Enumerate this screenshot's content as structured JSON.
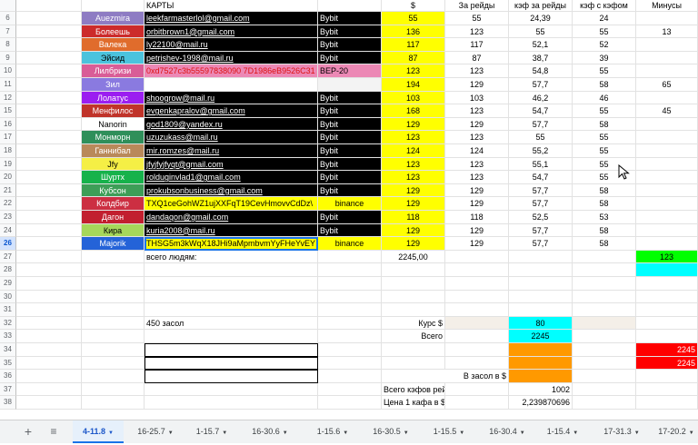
{
  "columns": [
    "col-name",
    "col-contact",
    "col-exchange",
    "col-dollar",
    "col-raids",
    "col-kaf-raids",
    "col-kaf-with-kaf",
    "col-minus"
  ],
  "header_row": {
    "row": "",
    "cells": [
      "",
      "КАРТЫ",
      "",
      "$",
      "За рейды",
      "кэф за рейды",
      "кэф с кэфом",
      "Минусы"
    ]
  },
  "rows": [
    {
      "row": "6",
      "name": "Auezmira",
      "contact": "leekfarmasterlol@gmail.com",
      "exchange": "Bybit",
      "dollar": "55",
      "raids": "55",
      "kaf": "24,39",
      "kafkaf": "24",
      "minus": ""
    },
    {
      "row": "7",
      "name": "Болеешь",
      "contact": "orbitbrown1@gmail.com",
      "exchange": "Bybit",
      "dollar": "136",
      "raids": "123",
      "kaf": "55",
      "kafkaf": "55",
      "minus": "13"
    },
    {
      "row": "8",
      "name": "Валека",
      "contact": "ly22100@mail.ru",
      "exchange": "Bybit",
      "dollar": "117",
      "raids": "117",
      "kaf": "52,1",
      "kafkaf": "52",
      "minus": ""
    },
    {
      "row": "9",
      "name": "Эйсид",
      "contact": "petrishev-1998@mail.ru",
      "exchange": "Bybit",
      "dollar": "87",
      "raids": "87",
      "kaf": "38,7",
      "kafkaf": "39",
      "minus": ""
    },
    {
      "row": "10",
      "name": "Лилбризи",
      "contact": "0xd7527c3b55597838090 7D1986eB9526C31",
      "exchange": "BEP-20",
      "dollar": "123",
      "raids": "123",
      "kaf": "54,8",
      "kafkaf": "55",
      "minus": ""
    },
    {
      "row": "11",
      "name": "Зил",
      "contact": "",
      "exchange": "",
      "dollar": "194",
      "raids": "129",
      "kaf": "57,7",
      "kafkaf": "58",
      "minus": "65"
    },
    {
      "row": "12",
      "name": "Лолатус",
      "contact": "shoogrow@mail.ru",
      "exchange": "Bybit",
      "dollar": "103",
      "raids": "103",
      "kaf": "46,2",
      "kafkaf": "46",
      "minus": ""
    },
    {
      "row": "15",
      "name": "Менфилос",
      "contact": "evgenkapralov@gmail.com",
      "exchange": "Bybit",
      "dollar": "168",
      "raids": "123",
      "kaf": "54,7",
      "kafkaf": "55",
      "minus": "45"
    },
    {
      "row": "16",
      "name": "Nanorin",
      "contact": "god1809@yandex.ru",
      "exchange": "Bybit",
      "dollar": "129",
      "raids": "129",
      "kaf": "57,7",
      "kafkaf": "58",
      "minus": ""
    },
    {
      "row": "17",
      "name": "Монморн",
      "contact": "uzuzukass@mail.ru",
      "exchange": "Bybit",
      "dollar": "123",
      "raids": "123",
      "kaf": "55",
      "kafkaf": "55",
      "minus": ""
    },
    {
      "row": "18",
      "name": "Ганнибал",
      "contact": "mir.romzes@mail.ru",
      "exchange": "Bybit",
      "dollar": "124",
      "raids": "124",
      "kaf": "55,2",
      "kafkaf": "55",
      "minus": ""
    },
    {
      "row": "19",
      "name": "Jfy",
      "contact": "jfyjfyjfyqt@gmail.com",
      "exchange": "Bybit",
      "dollar": "123",
      "raids": "123",
      "kaf": "55,1",
      "kafkaf": "55",
      "minus": ""
    },
    {
      "row": "20",
      "name": "Шуртх",
      "contact": "rolduginvlad1@gmail.com",
      "exchange": "Bybit",
      "dollar": "123",
      "raids": "123",
      "kaf": "54,7",
      "kafkaf": "55",
      "minus": ""
    },
    {
      "row": "21",
      "name": "Кубсон",
      "contact": "prokubsonbusiness@gmail.com",
      "exchange": "Bybit",
      "dollar": "129",
      "raids": "129",
      "kaf": "57,7",
      "kafkaf": "58",
      "minus": ""
    },
    {
      "row": "22",
      "name": "Колдбир",
      "contact": "TXQ1ceGohWZ1ujXXFqT19CevHmovvCdDz\\",
      "exchange": "binance",
      "dollar": "129",
      "raids": "129",
      "kaf": "57,7",
      "kafkaf": "58",
      "minus": ""
    },
    {
      "row": "23",
      "name": "Дагон",
      "contact": "dandaqon@gmail.com",
      "exchange": "Bybit",
      "dollar": "118",
      "raids": "118",
      "kaf": "52,5",
      "kafkaf": "53",
      "minus": ""
    },
    {
      "row": "24",
      "name": "Кира",
      "contact": "kuria2008@mail.ru",
      "exchange": "Bybit",
      "dollar": "129",
      "raids": "129",
      "kaf": "57,7",
      "kafkaf": "58",
      "minus": ""
    },
    {
      "row": "26",
      "name": "Majorik",
      "contact": "THSG5m3kWqX18JHi9aMpmbvmYyFHeYvEY",
      "exchange": "binance",
      "dollar": "129",
      "raids": "129",
      "kaf": "57,7",
      "kafkaf": "58",
      "minus": ""
    }
  ],
  "row27": {
    "row": "27",
    "label": "всего людям:",
    "total": "2245,00",
    "minus_value": "123"
  },
  "empty_rows_a": [
    "28",
    "29",
    "30",
    "31"
  ],
  "row32": {
    "row": "32",
    "label": "450 засол",
    "kurs_label": "Курс $",
    "kurs_value": "80"
  },
  "row33": {
    "row": "33",
    "label": "Всего",
    "value": "2245"
  },
  "row34": {
    "row": "34",
    "minus_value": "2245"
  },
  "row35": {
    "row": "35",
    "minus_value": "2245"
  },
  "row36": {
    "row": "36",
    "label": "В засол в $"
  },
  "row37": {
    "row": "37",
    "label": "Всего кэфов  рейд",
    "value": "1002"
  },
  "row38": {
    "row": "38",
    "label": "Цена 1 кафа в $",
    "value": "2,239870696"
  },
  "name_colors": {
    "Auezmira": "#8e7cc3",
    "Болеешь": "#cc2b2b",
    "Валека": "#e06c2c",
    "Эйсид": "#4bc3dd",
    "Лилбризи": "#d95d97",
    "Зил": "#8a7ae0",
    "Лолатус": "#9b1ef0",
    "Менфилос": "#c0342a",
    "Nanorin": "#ffffff",
    "Монморн": "#2f8f5a",
    "Ганнибал": "#b9895a",
    "Jfy": "#f5ef45",
    "Шуртх": "#16b24b",
    "Кубсон": "#3d9e57",
    "Колдбир": "#cc2f42",
    "Дагон": "#c21f2f",
    "Кира": "#a6d75b",
    "Majorik": "#2463d8"
  },
  "tabs": [
    "4-11.8",
    "16-25.7",
    "1-15.7",
    "16-30.6",
    "1-15.6",
    "16-30.5",
    "1-15.5",
    "16-30.4",
    "1-15.4",
    "17-31.3",
    "17-20.2"
  ],
  "active_tab": "4-11.8",
  "icons": {
    "add": "plus-icon",
    "all_sheets": "sheets-menu-icon",
    "cursor": "mouse-pointer-icon"
  }
}
